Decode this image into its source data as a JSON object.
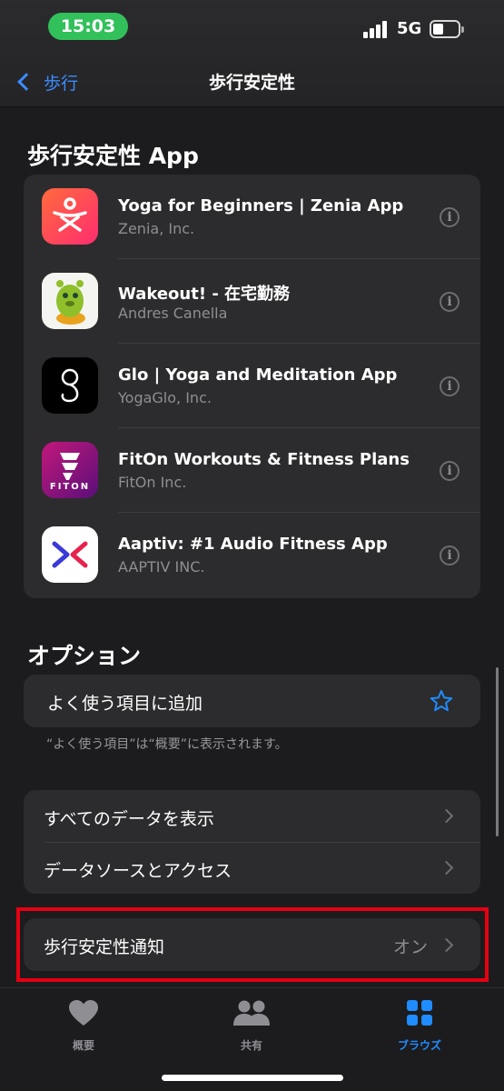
{
  "status_bar": {
    "time": "15:03",
    "network": "5G"
  },
  "nav": {
    "back_label": "歩行",
    "title": "歩行安定性"
  },
  "apps_section": {
    "title": "歩行安定性 App",
    "apps": [
      {
        "name": "Yoga for Beginners | Zenia App",
        "developer": "Zenia, Inc."
      },
      {
        "name": "Wakeout! - 在宅勤務",
        "developer": "Andres Canella"
      },
      {
        "name": "Glo | Yoga and Meditation App",
        "developer": "YogaGlo, Inc."
      },
      {
        "name": "FitOn Workouts & Fitness Plans",
        "developer": "FitOn Inc.",
        "icon_text": "FITON"
      },
      {
        "name": "Aaptiv: #1 Audio Fitness App",
        "developer": "AAPTIV INC."
      }
    ]
  },
  "options_section": {
    "title": "オプション",
    "favorite_label": "よく使う項目に追加",
    "favorite_note": "“よく使う項目”は“概要”に表示されます。",
    "show_all_data": "すべてのデータを表示",
    "data_sources": "データソースとアクセス",
    "notification_label": "歩行安定性通知",
    "notification_value": "オン"
  },
  "tabbar": {
    "summary": "概要",
    "sharing": "共有",
    "browse": "ブラウズ"
  },
  "colors": {
    "accent": "#1f8cff",
    "background": "#1c1c1e",
    "card": "#2c2c2e",
    "highlight": "#e60012",
    "status_pill": "#32c05a"
  }
}
